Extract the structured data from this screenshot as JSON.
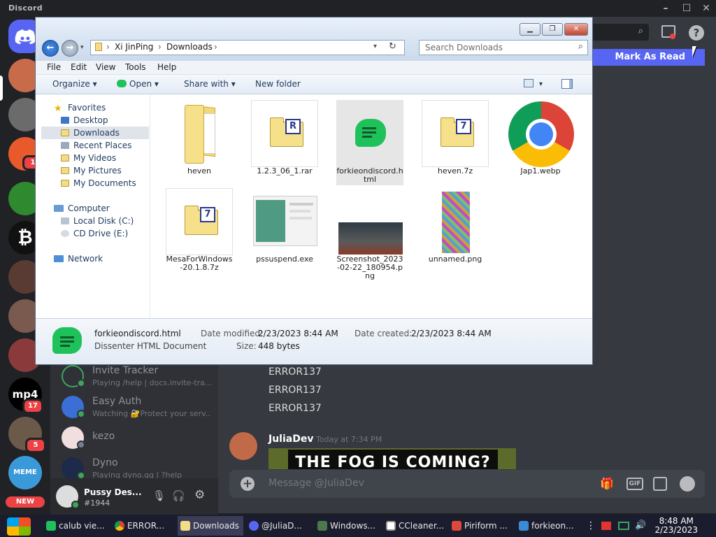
{
  "discord": {
    "app_title": "Discord",
    "mark_as_read": "Mark As Read",
    "members": [
      {
        "name": "Invite Tracker",
        "status": "Playing /help | docs.invite-tra..."
      },
      {
        "name": "Easy Auth",
        "status": "Watching 🔐Protect your serv..."
      },
      {
        "name": "kezo",
        "status": ""
      },
      {
        "name": "Dyno",
        "status": "Playing dyno.gg | ?help"
      }
    ],
    "user": {
      "name": "Pussy Des...",
      "tag": "#1944"
    },
    "messages": [
      "ERROR137",
      "ERROR137",
      "ERROR137"
    ],
    "last_author": {
      "name": "JuliaDev",
      "time": "Today at 7:34 PM"
    },
    "meme_caption": "THE FOG IS COMING?",
    "composer_placeholder": "Message @JuliaDev",
    "gif_label": "GIF",
    "badges": {
      "srv1": "1",
      "srv2": "17",
      "srv3": "5"
    },
    "server_labels": {
      "mp4": "mp4",
      "new": "NEW",
      "meme": "MEME"
    }
  },
  "explorer": {
    "breadcrumb": [
      "Xi JinPing",
      "Downloads"
    ],
    "search_placeholder": "Search Downloads",
    "menu": [
      "File",
      "Edit",
      "View",
      "Tools",
      "Help"
    ],
    "toolbar": {
      "organize": "Organize",
      "open": "Open",
      "share": "Share with",
      "newfolder": "New folder"
    },
    "nav": {
      "favorites": "Favorites",
      "fav_items": [
        "Desktop",
        "Downloads",
        "Recent Places",
        "My Videos",
        "My Pictures",
        "My Documents"
      ],
      "computer": "Computer",
      "drives": [
        "Local Disk (C:)",
        "CD Drive (E:)"
      ],
      "network": "Network"
    },
    "files": [
      {
        "name": "heven",
        "type": "folder"
      },
      {
        "name": "1.2.3_06_1.rar",
        "type": "rar"
      },
      {
        "name": "forkieondiscord.html",
        "type": "html"
      },
      {
        "name": "heven.7z",
        "type": "7z"
      },
      {
        "name": "Jap1.webp",
        "type": "chrome"
      },
      {
        "name": "MesaForWindows-20.1.8.7z",
        "type": "7z"
      },
      {
        "name": "pssuspend.exe",
        "type": "exe"
      },
      {
        "name": "Screenshot_2023-02-22_180954.png",
        "type": "png"
      },
      {
        "name": "unnamed.png",
        "type": "png2"
      }
    ],
    "details": {
      "filename": "forkieondiscord.html",
      "filetype": "Dissenter HTML Document",
      "modified_label": "Date modified:",
      "modified": "2/23/2023 8:44 AM",
      "created_label": "Date created:",
      "created": "2/23/2023 8:44 AM",
      "size_label": "Size:",
      "size": "448 bytes"
    }
  },
  "taskbar": {
    "tasks": [
      "calub vie...",
      "ERROR...",
      "Downloads",
      "@JuliaD...",
      "Windows...",
      "CCleaner...",
      "Piriform ...",
      "forkieon..."
    ],
    "time": "8:48 AM",
    "date": "2/23/2023"
  }
}
